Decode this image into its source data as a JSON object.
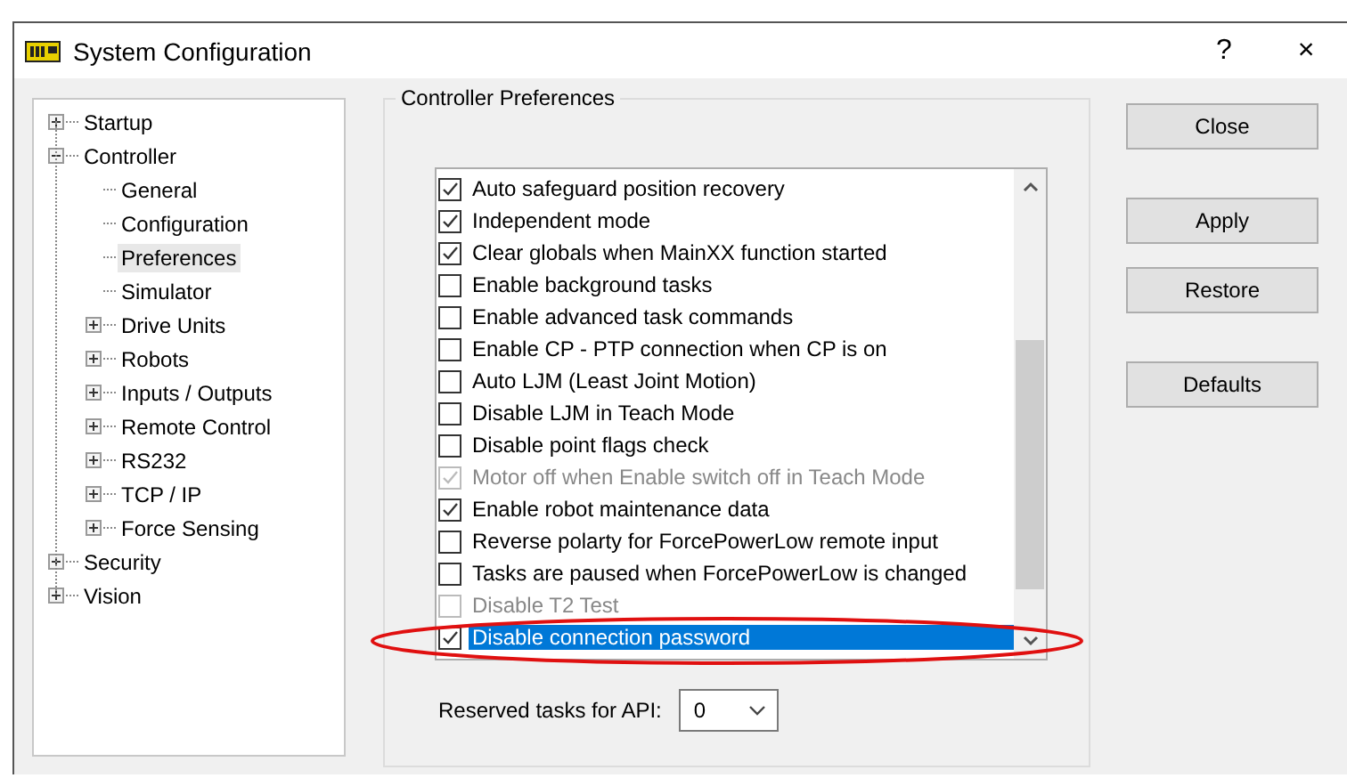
{
  "window": {
    "title": "System Configuration",
    "help": "?",
    "close": "×"
  },
  "tree": [
    {
      "label": "Startup",
      "expanded": false,
      "selected": false
    },
    {
      "label": "Controller",
      "expanded": true,
      "selected": false,
      "children": [
        {
          "label": "General",
          "selected": false
        },
        {
          "label": "Configuration",
          "selected": false
        },
        {
          "label": "Preferences",
          "selected": true
        },
        {
          "label": "Simulator",
          "selected": false
        },
        {
          "label": "Drive Units",
          "expanded": false,
          "selected": false
        },
        {
          "label": "Robots",
          "expanded": false,
          "selected": false
        },
        {
          "label": "Inputs / Outputs",
          "expanded": false,
          "selected": false
        },
        {
          "label": "Remote Control",
          "expanded": false,
          "selected": false
        },
        {
          "label": "RS232",
          "expanded": false,
          "selected": false
        },
        {
          "label": "TCP / IP",
          "expanded": false,
          "selected": false
        },
        {
          "label": "Force Sensing",
          "expanded": false,
          "selected": false
        }
      ]
    },
    {
      "label": "Security",
      "expanded": false,
      "selected": false
    },
    {
      "label": "Vision",
      "expanded": false,
      "selected": false
    }
  ],
  "group": {
    "title": "Controller Preferences",
    "options": [
      {
        "label": "Auto safeguard position recovery",
        "checked": true,
        "disabled": false,
        "selected": false
      },
      {
        "label": "Independent mode",
        "checked": true,
        "disabled": false,
        "selected": false
      },
      {
        "label": "Clear globals when MainXX function started",
        "checked": true,
        "disabled": false,
        "selected": false
      },
      {
        "label": "Enable background tasks",
        "checked": false,
        "disabled": false,
        "selected": false
      },
      {
        "label": "Enable advanced task commands",
        "checked": false,
        "disabled": false,
        "selected": false
      },
      {
        "label": "Enable CP - PTP connection when CP is on",
        "checked": false,
        "disabled": false,
        "selected": false
      },
      {
        "label": "Auto LJM (Least Joint Motion)",
        "checked": false,
        "disabled": false,
        "selected": false
      },
      {
        "label": "Disable LJM in Teach Mode",
        "checked": false,
        "disabled": false,
        "selected": false
      },
      {
        "label": "Disable point flags check",
        "checked": false,
        "disabled": false,
        "selected": false
      },
      {
        "label": "Motor off when Enable switch off in Teach Mode",
        "checked": true,
        "disabled": true,
        "selected": false
      },
      {
        "label": "Enable robot maintenance data",
        "checked": true,
        "disabled": false,
        "selected": false
      },
      {
        "label": "Reverse polarty for ForcePowerLow remote input",
        "checked": false,
        "disabled": false,
        "selected": false
      },
      {
        "label": "Tasks are paused when ForcePowerLow is changed",
        "checked": false,
        "disabled": false,
        "selected": false
      },
      {
        "label": "Disable T2 Test",
        "checked": false,
        "disabled": true,
        "selected": false
      },
      {
        "label": "Disable connection password",
        "checked": true,
        "disabled": false,
        "selected": true
      }
    ],
    "reserved": {
      "label": "Reserved tasks for API:",
      "value": "0"
    }
  },
  "buttons": [
    "Close",
    "Apply",
    "Restore",
    "Defaults"
  ]
}
